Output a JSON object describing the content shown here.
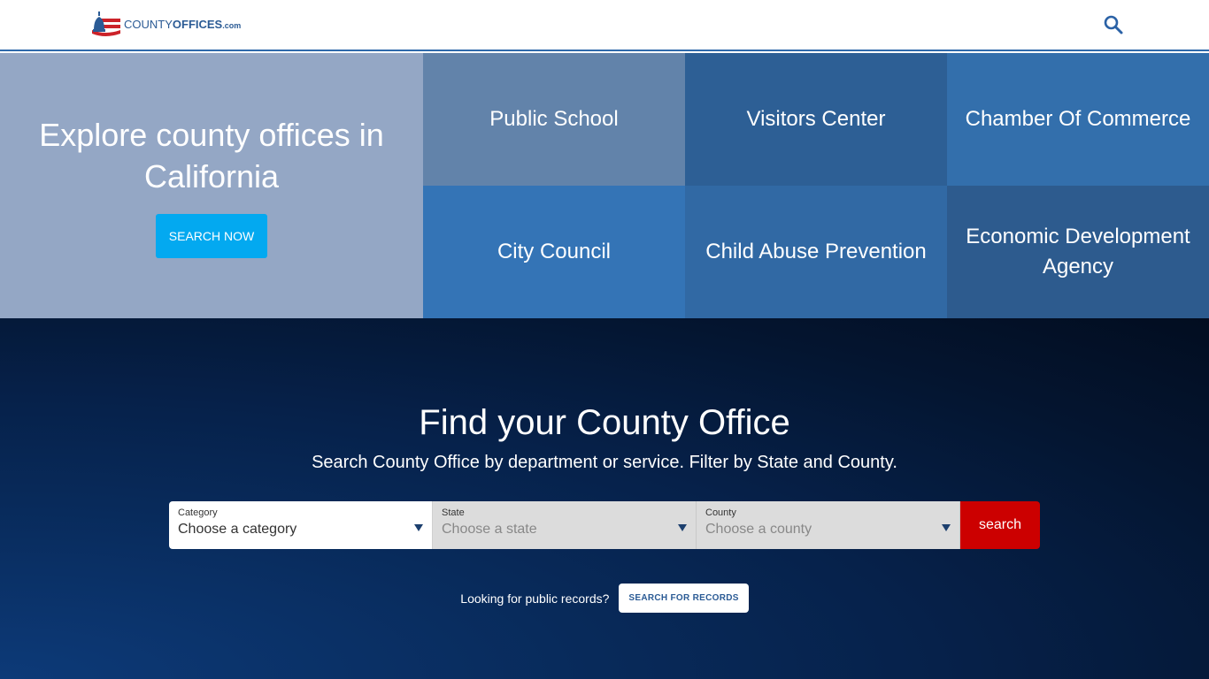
{
  "header": {
    "logo": {
      "brand_bold_part_1": "COUNTY",
      "brand_bold_part_2": "OFFICES",
      "brand_suffix": ".com"
    },
    "search_icon": "search-icon"
  },
  "hero": {
    "title": "Explore county offices in California",
    "cta_label": "SEARCH NOW",
    "tiles": [
      {
        "label": "Public School",
        "color": "#6283aa"
      },
      {
        "label": "Visitors Center",
        "color": "#2d5f95"
      },
      {
        "label": "Chamber Of Commerce",
        "color": "#336fac"
      },
      {
        "label": "City Council",
        "color": "#3474b6"
      },
      {
        "label": "Child Abuse Prevention",
        "color": "#3169a4"
      },
      {
        "label": "Economic Development Agency",
        "color": "#2d5b8e"
      }
    ]
  },
  "finder": {
    "title": "Find your County Office",
    "subtitle": "Search County Office by department or service. Filter by State and County.",
    "fields": [
      {
        "label": "Category",
        "value": "Choose a category"
      },
      {
        "label": "State",
        "value": "Choose a state"
      },
      {
        "label": "County",
        "value": "Choose a county"
      }
    ],
    "search_label": "search",
    "records_prompt": "Looking for public records?",
    "records_button": "SEARCH FOR RECORDS"
  },
  "colors": {
    "brand_blue": "#2b5b95",
    "accent_cyan": "#03a9f0",
    "search_red": "#cc0000",
    "explore_panel": "#94a7c5"
  }
}
